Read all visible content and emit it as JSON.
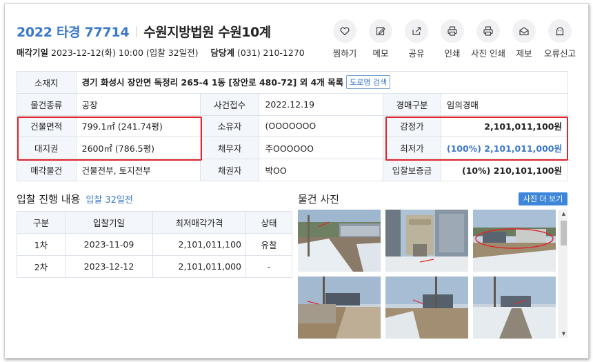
{
  "header": {
    "case_number": "2022 타경 77714",
    "court": "수원지방법원 수원10계",
    "sale_date_label": "매각기일",
    "sale_date_value": "2023-12-12(화) 10:00 (입찰 32일전)",
    "contact_label": "담당계",
    "contact_value": "(031) 210-1270"
  },
  "actions": [
    {
      "label": "찜하기",
      "icon": "heart-icon"
    },
    {
      "label": "메모",
      "icon": "memo-icon"
    },
    {
      "label": "공유",
      "icon": "share-icon"
    },
    {
      "label": "인쇄",
      "icon": "print-icon"
    },
    {
      "label": "사진 인쇄",
      "icon": "photo-print-icon"
    },
    {
      "label": "제보",
      "icon": "report-mail-icon"
    },
    {
      "label": "오류신고",
      "icon": "error-report-icon"
    }
  ],
  "info": {
    "address_label": "소재지",
    "address_value": "경기 화성시 장안면 독정리 265-4 1동 [장안로 480-72] 외 4개 목록",
    "road_search": "도로명 검색",
    "type_label": "물건종류",
    "type_value": "공장",
    "received_label": "사건접수",
    "received_value": "2022.12.19",
    "auction_type_label": "경매구분",
    "auction_type_value": "임의경매",
    "building_area_label": "건물면적",
    "building_area_value": "799.1㎡ (241.74평)",
    "owner_label": "소유자",
    "owner_value": "(OOOOOOO",
    "appraisal_label": "감정가",
    "appraisal_value": "2,101,011,100원",
    "land_label": "대지권",
    "land_value": "2600㎡ (786.5평)",
    "debtor_label": "채무자",
    "debtor_value": "주OOOOOO",
    "min_price_label": "최저가",
    "min_price_value": "(100%) 2,101,011,000원",
    "sale_items_label": "매각물건",
    "sale_items_value": "건물전부, 토지전부",
    "creditor_label": "채권자",
    "creditor_value": "박OO",
    "deposit_label": "입찰보증금",
    "deposit_value": "(10%) 210,101,100원"
  },
  "bidding": {
    "title": "입찰 진행 내용",
    "subtitle": "입찰 32일전",
    "headers": [
      "구분",
      "입찰기일",
      "최저매각가격",
      "상태"
    ],
    "rows": [
      [
        "1차",
        "2023-11-09",
        "2,101,011,100",
        "유찰"
      ],
      [
        "2차",
        "2023-12-12",
        "2,101,011,000",
        "-"
      ]
    ]
  },
  "photos": {
    "title": "물건 사진",
    "more_button": "사진 더 보기",
    "count": 6
  },
  "colors": {
    "accent_blue": "#3b78c9",
    "highlight_red": "#e0242a",
    "header_cell_bg": "#f3f6fa"
  }
}
